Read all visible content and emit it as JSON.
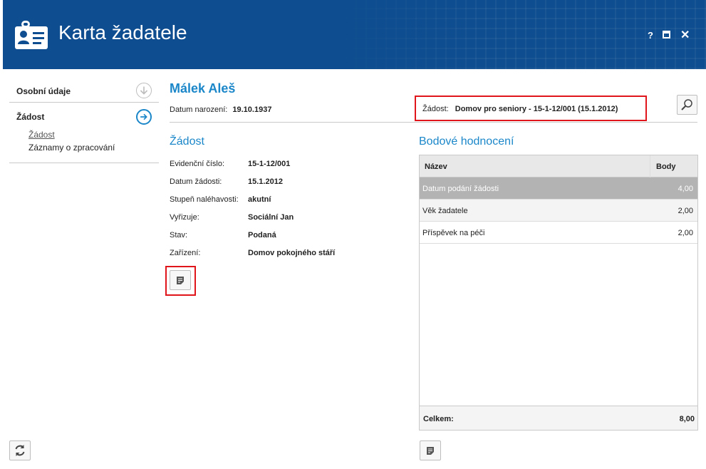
{
  "window": {
    "title": "Karta žadatele",
    "help_label": "?",
    "close_label": "✕"
  },
  "nav": {
    "items": [
      {
        "label": "Osobní údaje"
      },
      {
        "label": "Žádost"
      }
    ],
    "sub_items": [
      {
        "label": "Žádost",
        "active": true
      },
      {
        "label": "Záznamy o zpracování",
        "active": false
      }
    ]
  },
  "person": {
    "name": "Málek Aleš",
    "dob_label": "Datum narození:",
    "dob_value": "19.10.1937"
  },
  "request_selector": {
    "label": "Žádost:",
    "value": "Domov pro seniory - 15-1-12/001 (15.1.2012)"
  },
  "request_section": {
    "title": "Žádost",
    "fields": [
      {
        "label": "Evidenční číslo:",
        "value": "15-1-12/001"
      },
      {
        "label": "Datum žádosti:",
        "value": "15.1.2012"
      },
      {
        "label": "Stupeň naléhavosti:",
        "value": "akutní"
      },
      {
        "label": "Vyřizuje:",
        "value": "Sociální Jan"
      },
      {
        "label": "Stav:",
        "value": "Podaná"
      },
      {
        "label": "Zařízení:",
        "value": "Domov pokojného stáří"
      }
    ]
  },
  "scoring": {
    "title": "Bodové hodnocení",
    "columns": {
      "name": "Název",
      "points": "Body"
    },
    "rows": [
      {
        "name": "Datum podání žádosti",
        "points": "4,00"
      },
      {
        "name": "Věk žadatele",
        "points": "2,00"
      },
      {
        "name": "Příspěvek na péči",
        "points": "2,00"
      }
    ],
    "total_label": "Celkem:",
    "total_value": "8,00"
  },
  "icons": {
    "header": "id-card-icon",
    "refresh": "refresh-icon",
    "note": "note-icon",
    "search": "search-icon",
    "nav_personal": "arrow-down-circle-icon",
    "nav_request": "arrow-right-circle-icon"
  },
  "colors": {
    "header_bg": "#0e4d8f",
    "accent": "#1b87c9",
    "highlight_border": "#e0141b",
    "selected_row": "#b3b3b3"
  }
}
